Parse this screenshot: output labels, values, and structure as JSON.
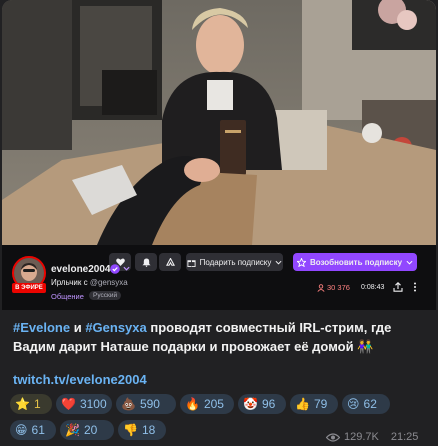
{
  "player": {
    "channel_name": "evelone2004",
    "stream_title": "Ирльчик с",
    "stream_handle": "@gensyxa",
    "category": "Общение",
    "tag": "Русский",
    "live_label": "В ЭФИРЕ",
    "gift_label": "Подарить подписку",
    "subscribe_label": "Возобновить подписку",
    "viewers": "30 376",
    "uptime": "0:08:43"
  },
  "message": {
    "hashtag1": "#Evelone",
    "and_word": " и ",
    "hashtag2": "#Gensyxa",
    "text": " проводят совместный IRL-стрим, где Вадим дарит Наташе подарки и провожает её домой 👫",
    "link": "twitch.tv/evelone2004"
  },
  "reactions": [
    {
      "emoji": "⭐",
      "count": "1"
    },
    {
      "emoji": "❤️",
      "count": "3100"
    },
    {
      "emoji": "💩",
      "count": "590"
    },
    {
      "emoji": "🔥",
      "count": "205"
    },
    {
      "emoji": "🤡",
      "count": "96"
    },
    {
      "emoji": "👍",
      "count": "79"
    },
    {
      "emoji": "😢",
      "count": "62"
    },
    {
      "emoji": "😁",
      "count": "61"
    },
    {
      "emoji": "🎉",
      "count": "20"
    },
    {
      "emoji": "👎",
      "count": "18"
    }
  ],
  "meta": {
    "views": "129.7K",
    "time": "21:25"
  },
  "colors": {
    "accent": "#9147ff",
    "live": "#eb0400",
    "link": "#6ab3f3"
  }
}
